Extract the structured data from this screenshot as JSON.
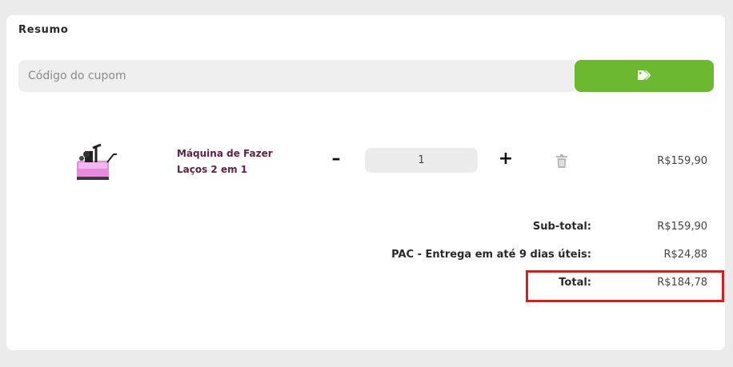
{
  "summary": {
    "title": "Resumo"
  },
  "coupon": {
    "placeholder": "Código do cupom",
    "button_icon": "tag-icon"
  },
  "cart_item": {
    "name": "Máquina de Fazer Laços 2 em 1",
    "quantity": "1",
    "price": "R$159,90",
    "minus_label": "–",
    "plus_label": "+",
    "remove_icon": "trash-icon"
  },
  "totals": {
    "subtotal_label": "Sub-total:",
    "subtotal_value": "R$159,90",
    "shipping_label": "PAC - Entrega em até 9 dias úteis:",
    "shipping_value": "R$24,88",
    "total_label": "Total:",
    "total_value": "R$184,78"
  },
  "colors": {
    "accent_green": "#6cb830",
    "product_name": "#5e1f49",
    "highlight_red": "#dd1b1b"
  }
}
